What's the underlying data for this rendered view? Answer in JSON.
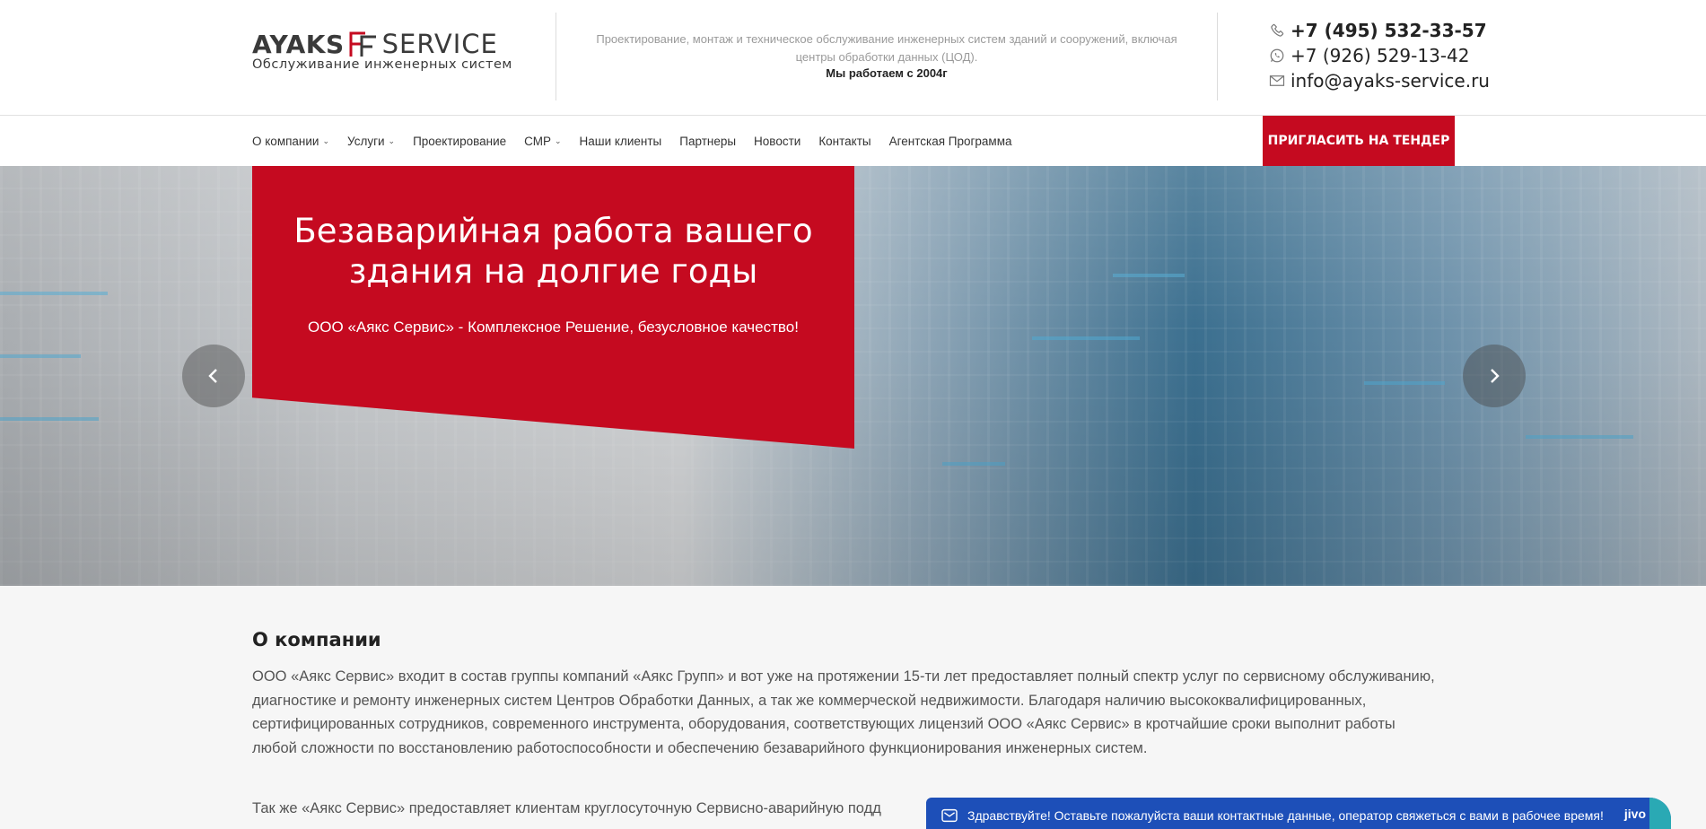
{
  "header": {
    "logo": {
      "brand_left": "AYAKS",
      "brand_right": "SERVICE",
      "subtitle": "Обслуживание инженерных систем"
    },
    "tagline": "Проектирование, монтаж и техническое обслуживание инженерных систем зданий и сооружений, включая центры обработки данных (ЦОД).",
    "since": "Мы работаем с 2004г",
    "contacts": {
      "phone_main": "+7 (495) 532-33-57",
      "phone_whatsapp": "+7 (926) 529-13-42",
      "email": "info@ayaks-service.ru"
    }
  },
  "nav": {
    "items": [
      {
        "label": "О компании",
        "dropdown": true
      },
      {
        "label": "Услуги",
        "dropdown": true
      },
      {
        "label": "Проектирование",
        "dropdown": false
      },
      {
        "label": "СМР",
        "dropdown": true
      },
      {
        "label": "Наши клиенты",
        "dropdown": false
      },
      {
        "label": "Партнеры",
        "dropdown": false
      },
      {
        "label": "Новости",
        "dropdown": false
      },
      {
        "label": "Контакты",
        "dropdown": false
      },
      {
        "label": "Агентская Программа",
        "dropdown": false
      }
    ],
    "chevron": "⌄",
    "tender_button": "ПРИГЛАСИТЬ НА ТЕНДЕР"
  },
  "hero": {
    "title": "Безаварийная работа вашего здания на долгие годы",
    "subtitle": "ООО «Аякс Сервис» - Комплексное Решение, безусловное качество!",
    "prev_icon": "chevron-left-icon",
    "next_icon": "chevron-right-icon"
  },
  "about": {
    "title": "О компании",
    "paragraph_1": "ООО «Аякс Сервис» входит в состав группы компаний «Аякс Групп» и вот уже на протяжении 15-ти лет предоставляет полный спектр услуг по сервисному обслуживанию, диагностике и ремонту инженерных систем Центров Обработки Данных, а так же коммерческой недвижимости. Благодаря наличию высококвалифицированных, сертифицированных сотрудников, современного инструмента, оборудования, соответствующих лицензий ООО «Аякс Сервис» в кротчайшие сроки выполнит работы любой сложности по восстановлению работоспособности и обеспечению безаварийного функционирования инженерных систем.",
    "paragraph_2": "Так же «Аякс Сервис» предоставляет клиентам круглосуточную Сервисно-аварийную подд"
  },
  "chat": {
    "message": "Здравствуйте! Оставьте пожалуйста ваши контактные данные, оператор свяжеться с вами в рабочее время!",
    "brand": "jivo"
  },
  "colors": {
    "accent_red": "#c50a20",
    "chat_blue": "#1d4fb8",
    "chat_teal": "#2aa9b4"
  }
}
